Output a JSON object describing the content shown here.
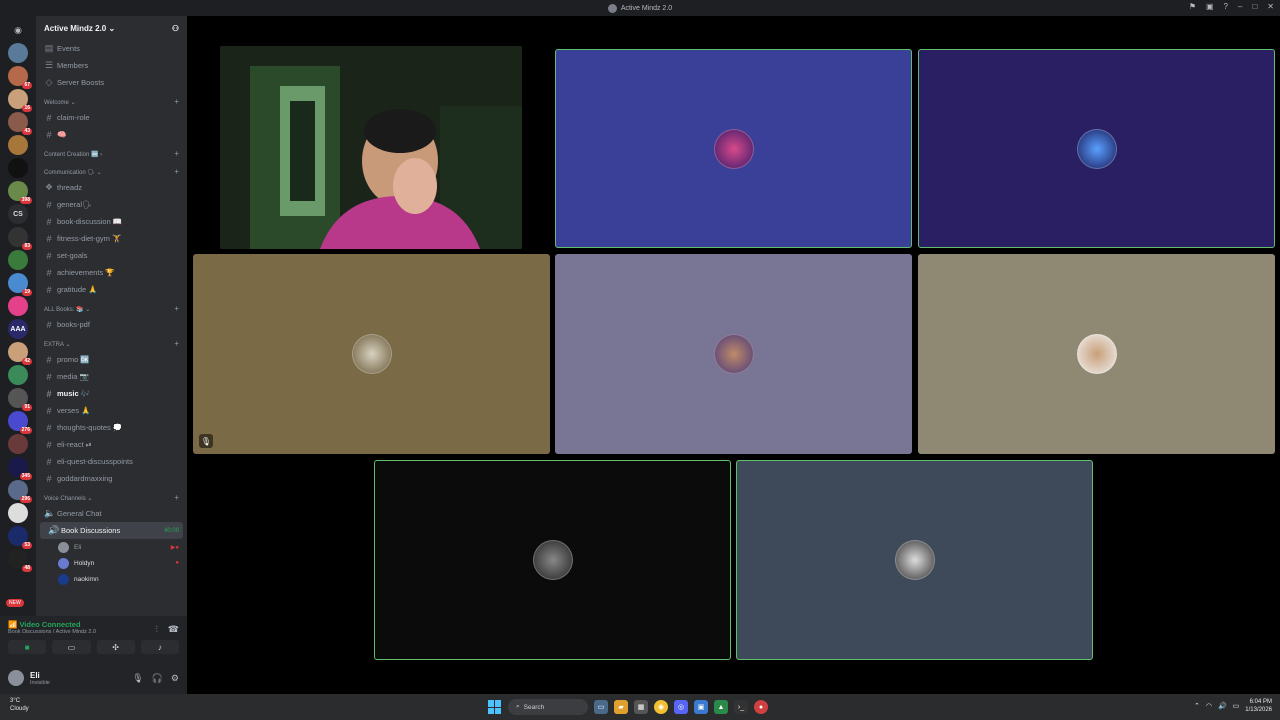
{
  "window": {
    "title": "Active Mindz 2.0"
  },
  "server": {
    "name": "Active Mindz 2.0"
  },
  "top_items": [
    {
      "label": "Events",
      "icon": "calendar-icon"
    },
    {
      "label": "Members",
      "icon": "members-icon"
    },
    {
      "label": "Server Boosts",
      "icon": "boost-icon"
    }
  ],
  "categories": {
    "welcome": "Welcome",
    "content_creation": "Content Creation 🆕",
    "communication": "Communication 🗣",
    "all_books": "ALL Books: 📚",
    "extra": "EXTRA",
    "voice": "Voice Channels"
  },
  "channels": {
    "welcome": [
      "claim-role",
      "🧠"
    ],
    "communication": [
      "threadz",
      "general🗣",
      "book-discussion 📖",
      "fitness-diet-gym 🏋",
      "set-goals",
      "achievements 🏆",
      "gratitude 🙏"
    ],
    "books": [
      "books-pdf"
    ],
    "extra": [
      "promo 🆗",
      "media 📷",
      "music 🎶",
      "verses 🙏",
      "thoughts-quotes 💭",
      "eli-react ⏯",
      "eli-quest-discusspoints",
      "goddardmaxxing"
    ],
    "voice": [
      "General Chat",
      "Book Discussions"
    ]
  },
  "voice_timer": "40:09",
  "voice_users": [
    "Eli",
    "Holdyn",
    "naokimn"
  ],
  "guild_badges": [
    "67",
    "16",
    "43",
    "398",
    "83",
    "19",
    "42",
    "91",
    "276",
    "345",
    "296",
    "53",
    "48"
  ],
  "guild_labels": {
    "cs": "CS",
    "aaa": "AAA",
    "new": "NEW"
  },
  "connection": {
    "status": "Video Connected",
    "location": "Book Discussions / Active Mindz 2.0"
  },
  "user": {
    "name": "Eli",
    "status": "Invisible"
  },
  "taskbar": {
    "weather_temp": "3°C",
    "weather_desc": "Cloudy",
    "search_placeholder": "Search",
    "time": "6:04 PM",
    "date": "1/13/2026"
  },
  "colors": {
    "tile_blue": "#3a3f98",
    "tile_indigo": "#2a1f63",
    "tile_olive": "#7a6a45",
    "tile_lavender": "#787595",
    "tile_khaki": "#8f8872",
    "tile_black": "#0b0b0b",
    "tile_slate": "#3e4a5a",
    "speaking": "#5fbf6d"
  }
}
